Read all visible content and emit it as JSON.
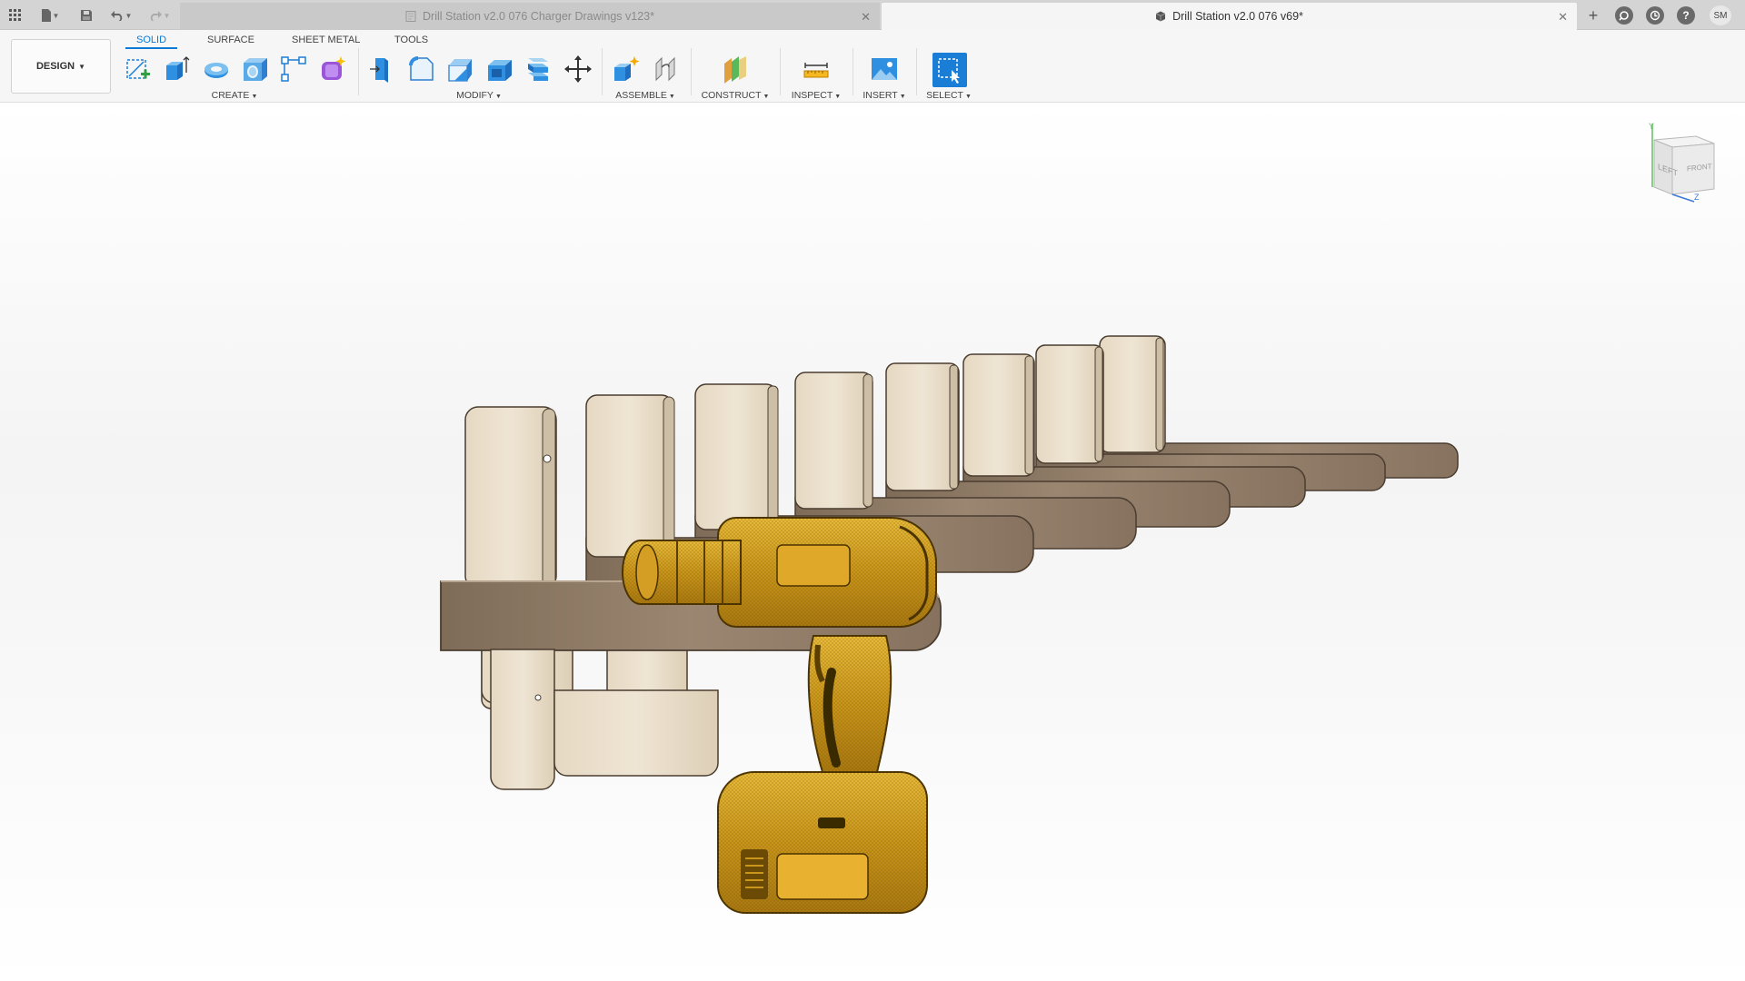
{
  "titlebar": {
    "tabs": [
      {
        "label": "Drill Station v2.0 076 Charger Drawings v123*",
        "active": false
      },
      {
        "label": "Drill Station v2.0 076 v69*",
        "active": true
      }
    ],
    "user_initials": "SM",
    "close_glyph": "✕",
    "new_tab_glyph": "+"
  },
  "workspace": {
    "label": "DESIGN"
  },
  "toolbar_tabs": [
    "SOLID",
    "SURFACE",
    "SHEET METAL",
    "TOOLS"
  ],
  "groups": {
    "create": "CREATE",
    "modify": "MODIFY",
    "assemble": "ASSEMBLE",
    "construct": "CONSTRUCT",
    "inspect": "INSPECT",
    "insert": "INSERT",
    "select": "SELECT"
  },
  "viewcube": {
    "left": "LEFT",
    "front": "FRONT",
    "axis_y": "Y",
    "axis_z": "Z"
  },
  "colors": {
    "accent": "#0a7ad6",
    "wood_light": "#e9ddc8",
    "wood_dark": "#8e7b66",
    "drill": "#d4a020"
  }
}
